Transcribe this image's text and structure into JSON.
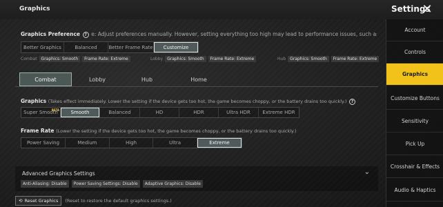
{
  "header": {
    "title": "Graphics",
    "settings_title": "Settings",
    "close_icon": "close-icon"
  },
  "preference": {
    "label": "Graphics Preference",
    "hint": "e: Adjust preferences manually. However, setting everything too high may lead to performance issues, such as overheating, battery drain, or choc",
    "options": [
      "Better Graphics",
      "Balanced",
      "Better Frame Rate",
      "Customize"
    ],
    "selected": "Customize",
    "summary": [
      {
        "label": "Combat",
        "tags": [
          "Graphics: Smooth",
          "Frame Rate: Extreme"
        ]
      },
      {
        "label": "Lobby",
        "tags": [
          "Graphics: Smooth",
          "Frame Rate: Extreme"
        ]
      },
      {
        "label": "Hub",
        "tags": [
          "Graphics: Smooth",
          "Frame Rate: Extreme"
        ]
      }
    ]
  },
  "tabs": {
    "items": [
      "Combat",
      "Lobby",
      "Hub",
      "Home"
    ],
    "selected": "Combat"
  },
  "graphics": {
    "label": "Graphics",
    "hint": "(Takes effect immediately. Lower the setting if the device gets too hot, the game becomes choppy, or the battery drains too quickly.)",
    "options": [
      "Super Smooth",
      "Smooth",
      "Balanced",
      "HD",
      "HDR",
      "Ultra HDR",
      "Extreme HDR"
    ],
    "beta_label": "BETA",
    "selected": "Smooth"
  },
  "frame_rate": {
    "label": "Frame Rate",
    "hint": "(Lower the setting if the device gets too hot, the game becomes choppy, or the battery drains too quickly.)",
    "options": [
      "Power Saving",
      "Medium",
      "High",
      "Ultra",
      "Extreme"
    ],
    "selected": "Extreme"
  },
  "advanced": {
    "label": "Advanced Graphics Settings",
    "tags": [
      "Anti-Aliasing: Disable",
      "Power Saving Settings: Disable",
      "Adaptive Graphics: Disable"
    ]
  },
  "reset": {
    "label": "Reset Graphics",
    "hint": "(Reset to restore the default graphics settings.)"
  },
  "sidebar": {
    "items": [
      "Account",
      "Controls",
      "Graphics",
      "Customize Buttons",
      "Sensitivity",
      "Pick Up",
      "Crosshair & Effects",
      "Audio & Haptics"
    ],
    "selected": "Graphics"
  },
  "colors": {
    "accent": "#f2c21b",
    "selected_segment": "#505a5a"
  }
}
